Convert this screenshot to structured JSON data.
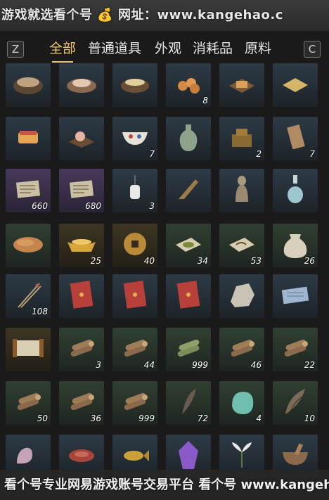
{
  "watermark_top": "游戏就选看个号 💰 网址：www.kangehao.c",
  "watermark_bottom": "看个号专业网易游戏账号交易平台 看个号 www.kangehao.com",
  "tabs": {
    "left_key": "Z",
    "right_key": "C",
    "items": [
      {
        "label": "全部",
        "active": true
      },
      {
        "label": "普通道具",
        "active": false
      },
      {
        "label": "外观",
        "active": false
      },
      {
        "label": "消耗品",
        "active": false
      },
      {
        "label": "原料",
        "active": false
      }
    ]
  },
  "grid": [
    [
      {
        "name": "stew-pot",
        "count": "",
        "tone": "blue"
      },
      {
        "name": "meat-plate",
        "count": "",
        "tone": "blue"
      },
      {
        "name": "soup-bowl",
        "count": "",
        "tone": "blue"
      },
      {
        "name": "buns",
        "count": "8",
        "tone": "blue"
      },
      {
        "name": "tofu-plate",
        "count": "",
        "tone": "blue"
      },
      {
        "name": "cake",
        "count": "",
        "tone": "blue"
      }
    ],
    [
      {
        "name": "pastry",
        "count": "",
        "tone": "blue"
      },
      {
        "name": "dumplings",
        "count": "",
        "tone": "blue"
      },
      {
        "name": "porcelain-bowl",
        "count": "7",
        "tone": "blue"
      },
      {
        "name": "vase",
        "count": "",
        "tone": "blue"
      },
      {
        "name": "ink-stone",
        "count": "2",
        "tone": "blue"
      },
      {
        "name": "tablet",
        "count": "7",
        "tone": "blue"
      }
    ],
    [
      {
        "name": "letter",
        "count": "660",
        "tone": "purple"
      },
      {
        "name": "letter",
        "count": "680",
        "tone": "purple"
      },
      {
        "name": "lantern",
        "count": "3",
        "tone": "blue"
      },
      {
        "name": "carpentry-square",
        "count": "",
        "tone": "blue"
      },
      {
        "name": "statue",
        "count": "",
        "tone": "blue"
      },
      {
        "name": "bottle",
        "count": "",
        "tone": "blue"
      }
    ],
    [
      {
        "name": "flatbread",
        "count": "",
        "tone": "green"
      },
      {
        "name": "gold-ingot",
        "count": "25",
        "tone": "gold"
      },
      {
        "name": "coin",
        "count": "40",
        "tone": "gold"
      },
      {
        "name": "herb-powder",
        "count": "34",
        "tone": "green"
      },
      {
        "name": "paper-item",
        "count": "53",
        "tone": "green"
      },
      {
        "name": "sack",
        "count": "26",
        "tone": "green"
      }
    ],
    [
      {
        "name": "arrow",
        "count": "108",
        "tone": "blue"
      },
      {
        "name": "red-envelope",
        "count": "",
        "tone": "blue"
      },
      {
        "name": "red-envelope",
        "count": "",
        "tone": "blue"
      },
      {
        "name": "red-envelope",
        "count": "",
        "tone": "blue"
      },
      {
        "name": "ore",
        "count": "",
        "tone": "blue"
      },
      {
        "name": "book",
        "count": "",
        "tone": "blue"
      }
    ],
    [
      {
        "name": "scroll",
        "count": "",
        "tone": "gold"
      },
      {
        "name": "logs",
        "count": "3",
        "tone": "green"
      },
      {
        "name": "logs",
        "count": "44",
        "tone": "green"
      },
      {
        "name": "bamboo",
        "count": "999",
        "tone": "green"
      },
      {
        "name": "logs",
        "count": "46",
        "tone": "green"
      },
      {
        "name": "logs",
        "count": "22",
        "tone": "green"
      }
    ],
    [
      {
        "name": "logs",
        "count": "50",
        "tone": "green"
      },
      {
        "name": "logs",
        "count": "36",
        "tone": "green"
      },
      {
        "name": "logs",
        "count": "999",
        "tone": "green"
      },
      {
        "name": "feather",
        "count": "72",
        "tone": "green"
      },
      {
        "name": "jade",
        "count": "4",
        "tone": "green"
      },
      {
        "name": "feathers",
        "count": "10",
        "tone": "green"
      }
    ],
    [
      {
        "name": "meat",
        "count": "",
        "tone": "blue"
      },
      {
        "name": "steak",
        "count": "",
        "tone": "blue"
      },
      {
        "name": "fish",
        "count": "",
        "tone": "blue"
      },
      {
        "name": "crystal",
        "count": "",
        "tone": "blue"
      },
      {
        "name": "herb",
        "count": "",
        "tone": "blue"
      },
      {
        "name": "mortar",
        "count": "",
        "tone": "blue"
      }
    ]
  ]
}
